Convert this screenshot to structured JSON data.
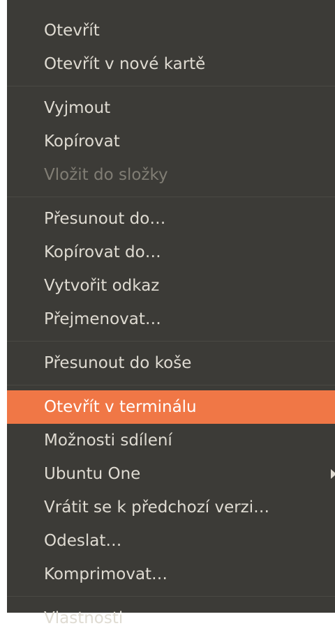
{
  "menu": {
    "items": [
      {
        "label": "Otevřít"
      },
      {
        "label": "Otevřít v nové kartě"
      },
      {
        "label": "Vyjmout"
      },
      {
        "label": "Kopírovat"
      },
      {
        "label": "Vložit do složky",
        "disabled": true
      },
      {
        "label": "Přesunout do…"
      },
      {
        "label": "Kopírovat do…"
      },
      {
        "label": "Vytvořit odkaz"
      },
      {
        "label": "Přejmenovat…"
      },
      {
        "label": "Přesunout do koše"
      },
      {
        "label": "Otevřít v terminálu",
        "highlighted": true
      },
      {
        "label": "Možnosti sdílení"
      },
      {
        "label": "Ubuntu One",
        "submenu": true
      },
      {
        "label": "Vrátit se k předchozí verzi…"
      },
      {
        "label": "Odeslat…"
      },
      {
        "label": "Komprimovat…"
      },
      {
        "label": "Vlastnosti"
      }
    ]
  },
  "colors": {
    "menu_bg": "#3c3b37",
    "text": "#dfdbd2",
    "disabled_text": "#807d74",
    "highlight": "#f07746"
  }
}
